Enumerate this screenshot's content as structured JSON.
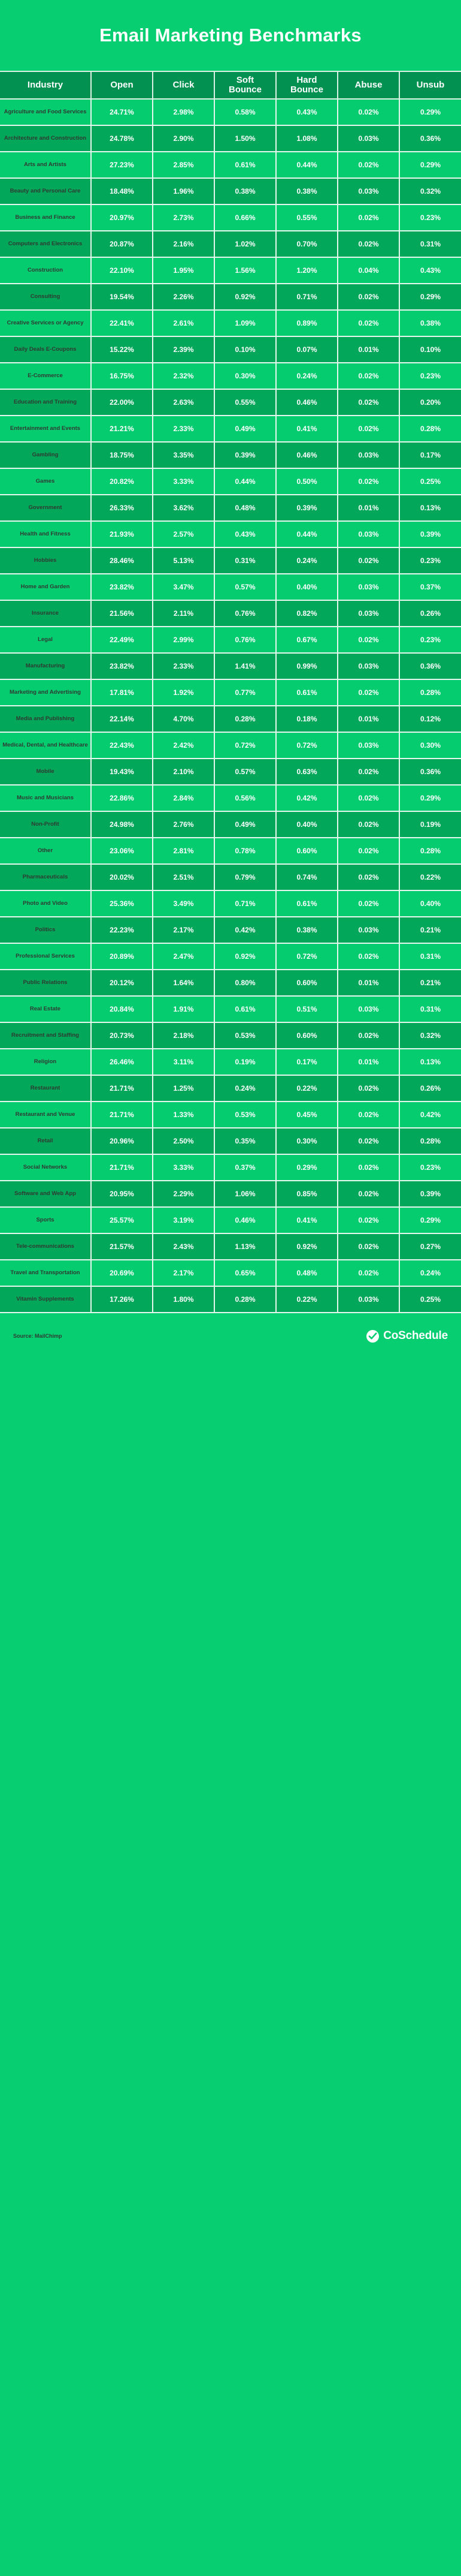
{
  "header": {
    "title": "Email Marketing Benchmarks"
  },
  "footer": {
    "source": "Source: MailChimp",
    "brand_name": "CoSchedule",
    "brand_icon": "check-circle-icon"
  },
  "chart_data": {
    "type": "table",
    "title": "Email Marketing Benchmarks",
    "columns": [
      "Industry",
      "Open",
      "Click",
      "Soft Bounce",
      "Hard Bounce",
      "Abuse",
      "Unsub"
    ],
    "column_labels_wrapped": [
      "Industry",
      "Open",
      "Click",
      "Soft\nBounce",
      "Hard\nBounce",
      "Abuse",
      "Unsub"
    ],
    "rows": [
      {
        "industry": "Agriculture and Food Services",
        "open": "24.71%",
        "click": "2.98%",
        "soft_bounce": "0.58%",
        "hard_bounce": "0.43%",
        "abuse": "0.02%",
        "unsub": "0.29%"
      },
      {
        "industry": "Architecture and Construction",
        "open": "24.78%",
        "click": "2.90%",
        "soft_bounce": "1.50%",
        "hard_bounce": "1.08%",
        "abuse": "0.03%",
        "unsub": "0.36%"
      },
      {
        "industry": "Arts and Artists",
        "open": "27.23%",
        "click": "2.85%",
        "soft_bounce": "0.61%",
        "hard_bounce": "0.44%",
        "abuse": "0.02%",
        "unsub": "0.29%"
      },
      {
        "industry": "Beauty and Personal Care",
        "open": "18.48%",
        "click": "1.96%",
        "soft_bounce": "0.38%",
        "hard_bounce": "0.38%",
        "abuse": "0.03%",
        "unsub": "0.32%"
      },
      {
        "industry": "Business and Finance",
        "open": "20.97%",
        "click": "2.73%",
        "soft_bounce": "0.66%",
        "hard_bounce": "0.55%",
        "abuse": "0.02%",
        "unsub": "0.23%"
      },
      {
        "industry": "Computers and Electronics",
        "open": "20.87%",
        "click": "2.16%",
        "soft_bounce": "1.02%",
        "hard_bounce": "0.70%",
        "abuse": "0.02%",
        "unsub": "0.31%"
      },
      {
        "industry": "Construction",
        "open": "22.10%",
        "click": "1.95%",
        "soft_bounce": "1.56%",
        "hard_bounce": "1.20%",
        "abuse": "0.04%",
        "unsub": "0.43%"
      },
      {
        "industry": "Consulting",
        "open": "19.54%",
        "click": "2.26%",
        "soft_bounce": "0.92%",
        "hard_bounce": "0.71%",
        "abuse": "0.02%",
        "unsub": "0.29%"
      },
      {
        "industry": "Creative Services or Agency",
        "open": "22.41%",
        "click": "2.61%",
        "soft_bounce": "1.09%",
        "hard_bounce": "0.89%",
        "abuse": "0.02%",
        "unsub": "0.38%"
      },
      {
        "industry": "Daily Deals E-Coupons",
        "open": "15.22%",
        "click": "2.39%",
        "soft_bounce": "0.10%",
        "hard_bounce": "0.07%",
        "abuse": "0.01%",
        "unsub": "0.10%"
      },
      {
        "industry": "E-Commerce",
        "open": "16.75%",
        "click": "2.32%",
        "soft_bounce": "0.30%",
        "hard_bounce": "0.24%",
        "abuse": "0.02%",
        "unsub": "0.23%"
      },
      {
        "industry": "Education and Training",
        "open": "22.00%",
        "click": "2.63%",
        "soft_bounce": "0.55%",
        "hard_bounce": "0.46%",
        "abuse": "0.02%",
        "unsub": "0.20%"
      },
      {
        "industry": "Entertainment and Events",
        "open": "21.21%",
        "click": "2.33%",
        "soft_bounce": "0.49%",
        "hard_bounce": "0.41%",
        "abuse": "0.02%",
        "unsub": "0.28%"
      },
      {
        "industry": "Gambling",
        "open": "18.75%",
        "click": "3.35%",
        "soft_bounce": "0.39%",
        "hard_bounce": "0.46%",
        "abuse": "0.03%",
        "unsub": "0.17%"
      },
      {
        "industry": "Games",
        "open": "20.82%",
        "click": "3.33%",
        "soft_bounce": "0.44%",
        "hard_bounce": "0.50%",
        "abuse": "0.02%",
        "unsub": "0.25%"
      },
      {
        "industry": "Government",
        "open": "26.33%",
        "click": "3.62%",
        "soft_bounce": "0.48%",
        "hard_bounce": "0.39%",
        "abuse": "0.01%",
        "unsub": "0.13%"
      },
      {
        "industry": "Health and Fitness",
        "open": "21.93%",
        "click": "2.57%",
        "soft_bounce": "0.43%",
        "hard_bounce": "0.44%",
        "abuse": "0.03%",
        "unsub": "0.39%"
      },
      {
        "industry": "Hobbies",
        "open": "28.46%",
        "click": "5.13%",
        "soft_bounce": "0.31%",
        "hard_bounce": "0.24%",
        "abuse": "0.02%",
        "unsub": "0.23%"
      },
      {
        "industry": "Home and Garden",
        "open": "23.82%",
        "click": "3.47%",
        "soft_bounce": "0.57%",
        "hard_bounce": "0.40%",
        "abuse": "0.03%",
        "unsub": "0.37%"
      },
      {
        "industry": "Insurance",
        "open": "21.56%",
        "click": "2.11%",
        "soft_bounce": "0.76%",
        "hard_bounce": "0.82%",
        "abuse": "0.03%",
        "unsub": "0.26%"
      },
      {
        "industry": "Legal",
        "open": "22.49%",
        "click": "2.99%",
        "soft_bounce": "0.76%",
        "hard_bounce": "0.67%",
        "abuse": "0.02%",
        "unsub": "0.23%"
      },
      {
        "industry": "Manufacturing",
        "open": "23.82%",
        "click": "2.33%",
        "soft_bounce": "1.41%",
        "hard_bounce": "0.99%",
        "abuse": "0.03%",
        "unsub": "0.36%"
      },
      {
        "industry": "Marketing and Advertising",
        "open": "17.81%",
        "click": "1.92%",
        "soft_bounce": "0.77%",
        "hard_bounce": "0.61%",
        "abuse": "0.02%",
        "unsub": "0.28%"
      },
      {
        "industry": "Media and Publishing",
        "open": "22.14%",
        "click": "4.70%",
        "soft_bounce": "0.28%",
        "hard_bounce": "0.18%",
        "abuse": "0.01%",
        "unsub": "0.12%"
      },
      {
        "industry": "Medical, Dental, and Healthcare",
        "open": "22.43%",
        "click": "2.42%",
        "soft_bounce": "0.72%",
        "hard_bounce": "0.72%",
        "abuse": "0.03%",
        "unsub": "0.30%"
      },
      {
        "industry": "Mobile",
        "open": "19.43%",
        "click": "2.10%",
        "soft_bounce": "0.57%",
        "hard_bounce": "0.63%",
        "abuse": "0.02%",
        "unsub": "0.36%"
      },
      {
        "industry": "Music and Musicians",
        "open": "22.86%",
        "click": "2.84%",
        "soft_bounce": "0.56%",
        "hard_bounce": "0.42%",
        "abuse": "0.02%",
        "unsub": "0.29%"
      },
      {
        "industry": "Non-Profit",
        "open": "24.98%",
        "click": "2.76%",
        "soft_bounce": "0.49%",
        "hard_bounce": "0.40%",
        "abuse": "0.02%",
        "unsub": "0.19%"
      },
      {
        "industry": "Other",
        "open": "23.06%",
        "click": "2.81%",
        "soft_bounce": "0.78%",
        "hard_bounce": "0.60%",
        "abuse": "0.02%",
        "unsub": "0.28%"
      },
      {
        "industry": "Pharmaceuticals",
        "open": "20.02%",
        "click": "2.51%",
        "soft_bounce": "0.79%",
        "hard_bounce": "0.74%",
        "abuse": "0.02%",
        "unsub": "0.22%"
      },
      {
        "industry": "Photo and Video",
        "open": "25.36%",
        "click": "3.49%",
        "soft_bounce": "0.71%",
        "hard_bounce": "0.61%",
        "abuse": "0.02%",
        "unsub": "0.40%"
      },
      {
        "industry": "Politics",
        "open": "22.23%",
        "click": "2.17%",
        "soft_bounce": "0.42%",
        "hard_bounce": "0.38%",
        "abuse": "0.03%",
        "unsub": "0.21%"
      },
      {
        "industry": "Professional Services",
        "open": "20.89%",
        "click": "2.47%",
        "soft_bounce": "0.92%",
        "hard_bounce": "0.72%",
        "abuse": "0.02%",
        "unsub": "0.31%"
      },
      {
        "industry": "Public Relations",
        "open": "20.12%",
        "click": "1.64%",
        "soft_bounce": "0.80%",
        "hard_bounce": "0.60%",
        "abuse": "0.01%",
        "unsub": "0.21%"
      },
      {
        "industry": "Real Estate",
        "open": "20.84%",
        "click": "1.91%",
        "soft_bounce": "0.61%",
        "hard_bounce": "0.51%",
        "abuse": "0.03%",
        "unsub": "0.31%"
      },
      {
        "industry": "Recruitment and Staffing",
        "open": "20.73%",
        "click": "2.18%",
        "soft_bounce": "0.53%",
        "hard_bounce": "0.60%",
        "abuse": "0.02%",
        "unsub": "0.32%"
      },
      {
        "industry": "Religion",
        "open": "26.46%",
        "click": "3.11%",
        "soft_bounce": "0.19%",
        "hard_bounce": "0.17%",
        "abuse": "0.01%",
        "unsub": "0.13%"
      },
      {
        "industry": "Restaurant",
        "open": "21.71%",
        "click": "1.25%",
        "soft_bounce": "0.24%",
        "hard_bounce": "0.22%",
        "abuse": "0.02%",
        "unsub": "0.26%"
      },
      {
        "industry": "Restaurant and Venue",
        "open": "21.71%",
        "click": "1.33%",
        "soft_bounce": "0.53%",
        "hard_bounce": "0.45%",
        "abuse": "0.02%",
        "unsub": "0.42%"
      },
      {
        "industry": "Retail",
        "open": "20.96%",
        "click": "2.50%",
        "soft_bounce": "0.35%",
        "hard_bounce": "0.30%",
        "abuse": "0.02%",
        "unsub": "0.28%"
      },
      {
        "industry": "Social Networks",
        "open": "21.71%",
        "click": "3.33%",
        "soft_bounce": "0.37%",
        "hard_bounce": "0.29%",
        "abuse": "0.02%",
        "unsub": "0.23%"
      },
      {
        "industry": "Software and Web App",
        "open": "20.95%",
        "click": "2.29%",
        "soft_bounce": "1.06%",
        "hard_bounce": "0.85%",
        "abuse": "0.02%",
        "unsub": "0.39%"
      },
      {
        "industry": "Sports",
        "open": "25.57%",
        "click": "3.19%",
        "soft_bounce": "0.46%",
        "hard_bounce": "0.41%",
        "abuse": "0.02%",
        "unsub": "0.29%"
      },
      {
        "industry": "Tele-communications",
        "open": "21.57%",
        "click": "2.43%",
        "soft_bounce": "1.13%",
        "hard_bounce": "0.92%",
        "abuse": "0.02%",
        "unsub": "0.27%"
      },
      {
        "industry": "Travel and Transportation",
        "open": "20.69%",
        "click": "2.17%",
        "soft_bounce": "0.65%",
        "hard_bounce": "0.48%",
        "abuse": "0.02%",
        "unsub": "0.24%"
      },
      {
        "industry": "Vitamin Supplements",
        "open": "17.26%",
        "click": "1.80%",
        "soft_bounce": "0.28%",
        "hard_bounce": "0.22%",
        "abuse": "0.03%",
        "unsub": "0.25%"
      }
    ]
  },
  "colors": {
    "brand_green": "#06ce71",
    "row_light": "#06cc70",
    "row_dark": "#02a759",
    "header_row": "#029150",
    "grid_line": "#e4f7ec",
    "text_light": "#ffffff",
    "text_dark": "#2f3a33"
  }
}
